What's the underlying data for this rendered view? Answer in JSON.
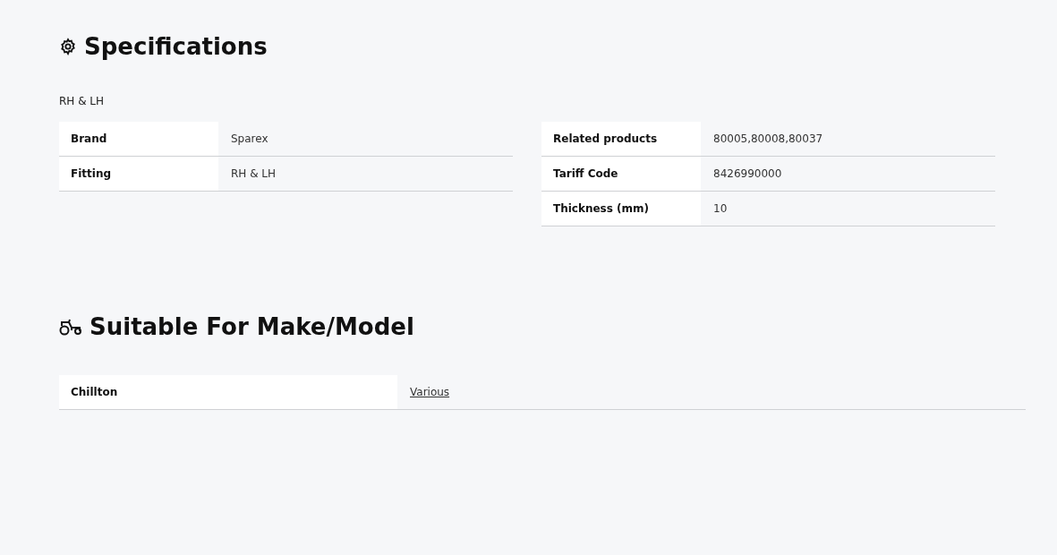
{
  "specifications": {
    "title": "Specifications",
    "summary": "RH & LH",
    "tables": [
      [
        {
          "label": "Brand",
          "value": "Sparex"
        },
        {
          "label": "Fitting",
          "value": "RH & LH"
        }
      ],
      [
        {
          "label": "Related products",
          "value": "80005,80008,80037"
        },
        {
          "label": "Tariff Code",
          "value": "8426990000"
        },
        {
          "label": "Thickness (mm)",
          "value": "10"
        }
      ]
    ]
  },
  "suitable": {
    "title": "Suitable For Make/Model",
    "rows": [
      {
        "make": "Chillton",
        "model": "Various"
      }
    ]
  }
}
